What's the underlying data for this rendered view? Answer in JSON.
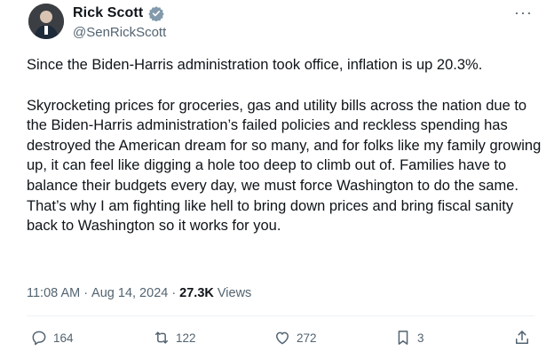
{
  "author": {
    "display_name": "Rick Scott",
    "handle": "@SenRickScott",
    "verified_icon": "verified-badge-icon",
    "verified_color": "#829aab"
  },
  "tweet": {
    "paragraph_1": "Since the Biden-Harris administration took office, inflation is up 20.3%.",
    "paragraph_2": "Skyrocketing prices for groceries, gas and utility bills across the nation due to the Biden-Harris administration’s failed policies and reckless spending has destroyed the American dream for so many, and for folks like my family growing up, it can feel like digging a hole too deep to climb out of. Families have to balance their budgets every day, we must force Washington to do the same. That’s why I am fighting like hell to bring down prices and bring fiscal sanity back to Washington so it works for you."
  },
  "meta": {
    "time": "11:08 AM",
    "separator": "·",
    "date": "Aug 14, 2024",
    "views_count": "27.3K",
    "views_label": "Views"
  },
  "actions": {
    "replies": "164",
    "reposts": "122",
    "likes": "272",
    "bookmarks": "3"
  },
  "menu": {
    "more_label": "···"
  },
  "colors": {
    "text": "#0f1419",
    "secondary": "#536471",
    "divider": "#eff3f4"
  }
}
